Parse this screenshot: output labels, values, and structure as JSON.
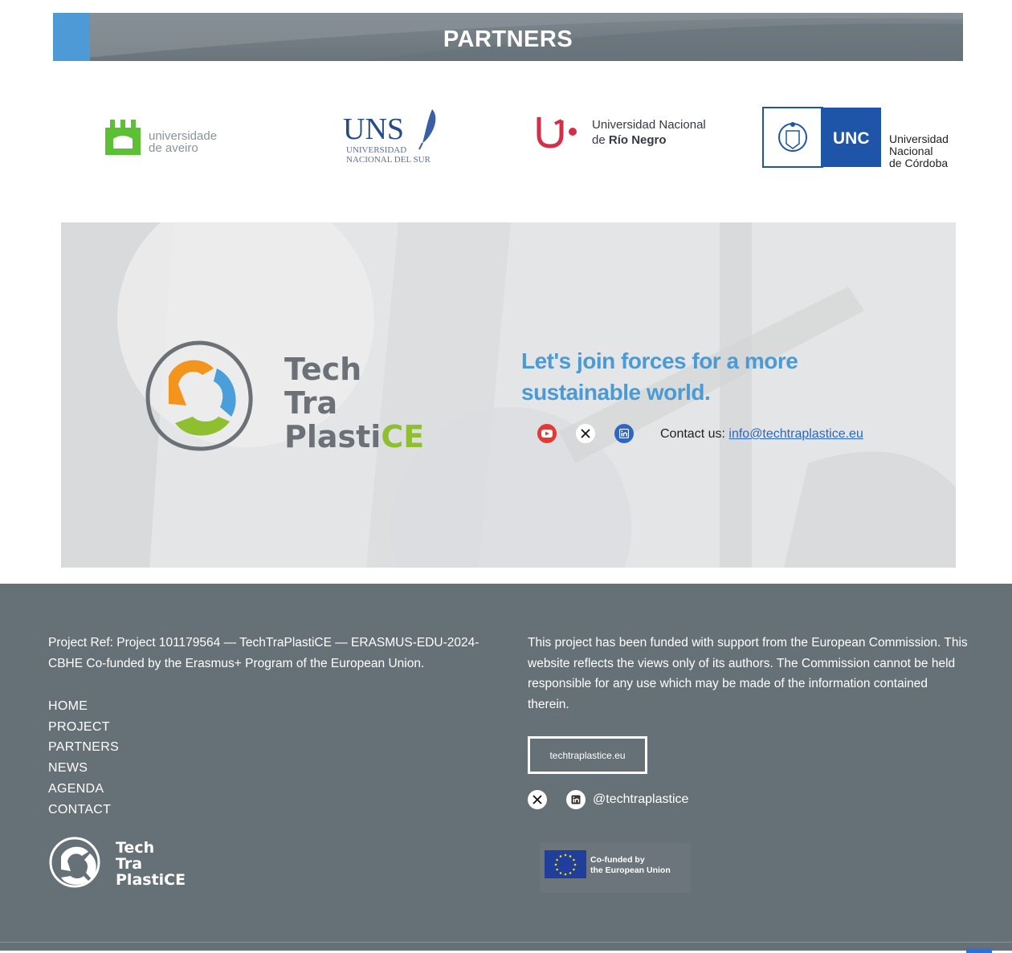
{
  "partners_section": {
    "title": "PARTNERS",
    "logos": [
      {
        "name": "Universidade de Aveiro",
        "line1": "universidade",
        "line2": "de aveiro"
      },
      {
        "name": "Universidad Nacional del Sur",
        "abbr": "UNS",
        "line1": "UNIVERSIDAD",
        "line2": "NACIONAL DEL SUR"
      },
      {
        "name": "Universidad Nacional de Río Negro",
        "line1": "Universidad Nacional",
        "line2_prefix": "de ",
        "line2_bold": "Río Negro"
      },
      {
        "name": "Universidad Nacional de Córdoba",
        "abbr": "UNC",
        "line1": "Universidad",
        "line2": "Nacional",
        "line3": "de Córdoba"
      }
    ]
  },
  "hero": {
    "logo": {
      "line1": "Tech",
      "line2": "Tra",
      "line3_a": "Plasti",
      "line3_b": "CE"
    },
    "heading": "Let's join forces for a more sustainable world.",
    "social_icons": [
      "youtube-icon",
      "x-icon",
      "linkedin-icon"
    ],
    "contact_label": "Contact us:",
    "contact_email": "info@techtraplastice.eu"
  },
  "footer": {
    "project_ref": "Project Ref: Project 101179564 — TechTraPlastiCE — ERASMUS-EDU-2024-CBHE Co-funded by the Erasmus+ Program of the European Union.",
    "nav": [
      "HOME",
      "PROJECT",
      "PARTNERS",
      "NEWS",
      "AGENDA",
      "CONTACT"
    ],
    "logo": {
      "line1": "Tech",
      "line2": "Tra",
      "line3_a": "Plasti",
      "line3_b": "CE"
    },
    "disclaimer": "This project has been funded with support from the European Commission. This website reflects the views only of its authors. The Commission cannot be held responsible for any use which may be made of the information contained therein.",
    "site_button": "techtraplastice.eu",
    "handle": "@techtraplastice",
    "eu_badge": {
      "line1": "Co-funded by",
      "line2": "the European Union"
    }
  },
  "colors": {
    "accent_blue": "#4b9ad3",
    "footer_bg": "#667077",
    "ce_green": "#8dbf2e",
    "link_blue": "#2a66c9"
  }
}
